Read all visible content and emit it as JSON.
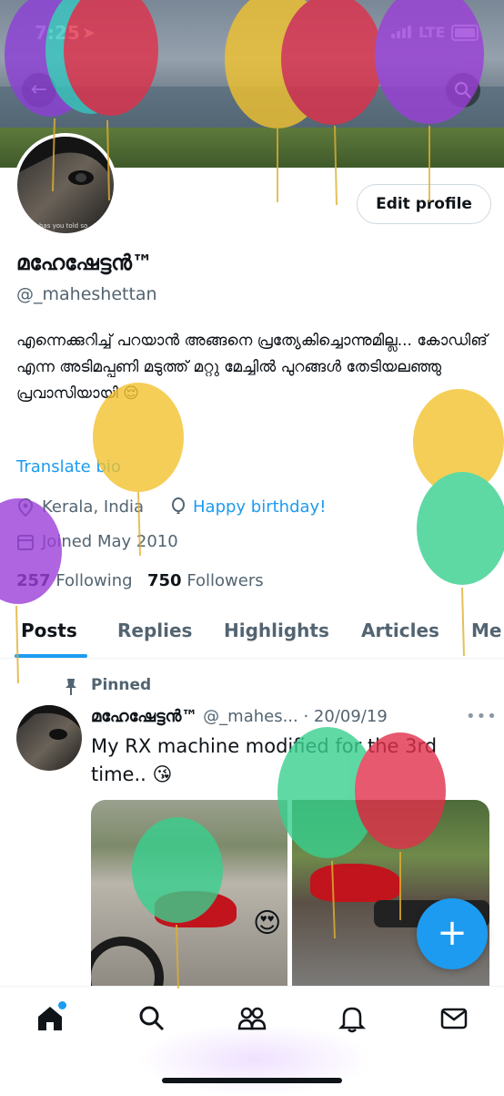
{
  "status_bar": {
    "time": "7:25",
    "network": "LTE"
  },
  "profile": {
    "name": "മഹേഷേട്ടൻ™",
    "handle": "@_maheshettan",
    "bio": "എന്നെക്കുറിച്ച് പറയാൻ അങ്ങനെ പ്രത്യേകിച്ചൊന്നുമില്ല... കോഡിങ് എന്ന അടിമപ്പണി മടുത്ത് മറ്റു മേച്ചിൽ പുറങ്ങൾ തേടിയലഞ്ഞു പ്രവാസിയായി 😌",
    "translate_label": "Translate bio",
    "location": "Kerala, India",
    "birthday": "Happy birthday!",
    "joined": "Joined May 2010",
    "following_count": "257",
    "following_label": "Following",
    "followers_count": "750",
    "followers_label": "Followers",
    "edit_profile_label": "Edit profile",
    "avatar_caption": "has you told so"
  },
  "tabs": [
    {
      "label": "Posts",
      "active": true
    },
    {
      "label": "Replies"
    },
    {
      "label": "Highlights"
    },
    {
      "label": "Articles"
    },
    {
      "label": "Me"
    }
  ],
  "pinned_post": {
    "pinned_label": "Pinned",
    "author_name": "മഹേഷേട്ടൻ™",
    "author_handle": "@_mahes...",
    "date": "· 20/09/19",
    "text": "My RX machine modified for the 3rd time.. 😘",
    "more": "•••"
  },
  "compose_button": "+",
  "bottom_nav": [
    "home-icon",
    "search-icon",
    "communities-icon",
    "notifications-icon",
    "messages-icon"
  ],
  "colors": {
    "accent": "#1d9bf0",
    "text": "#0f1419",
    "muted": "#536471"
  }
}
